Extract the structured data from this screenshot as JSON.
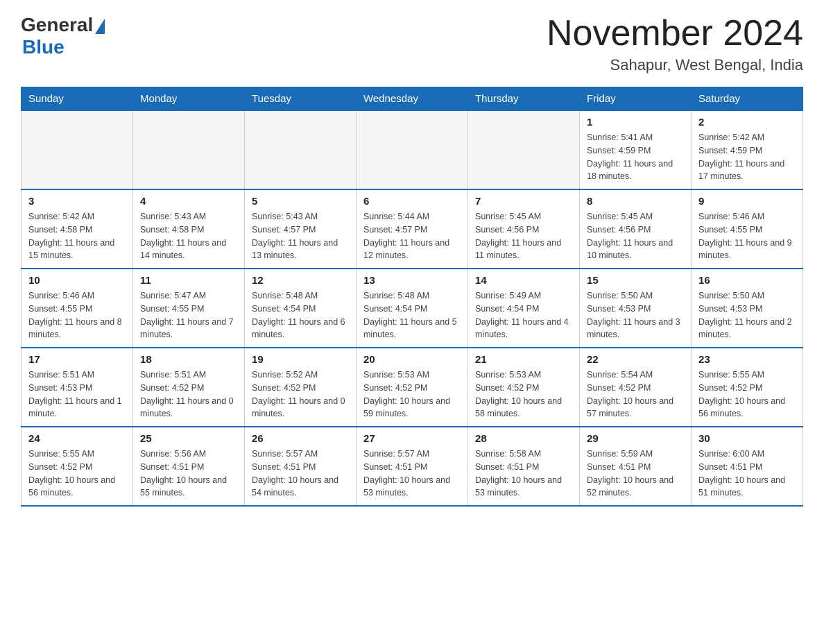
{
  "logo": {
    "general": "General",
    "blue": "Blue"
  },
  "title": "November 2024",
  "subtitle": "Sahapur, West Bengal, India",
  "days_of_week": [
    "Sunday",
    "Monday",
    "Tuesday",
    "Wednesday",
    "Thursday",
    "Friday",
    "Saturday"
  ],
  "weeks": [
    [
      {
        "day": "",
        "info": ""
      },
      {
        "day": "",
        "info": ""
      },
      {
        "day": "",
        "info": ""
      },
      {
        "day": "",
        "info": ""
      },
      {
        "day": "",
        "info": ""
      },
      {
        "day": "1",
        "info": "Sunrise: 5:41 AM\nSunset: 4:59 PM\nDaylight: 11 hours and 18 minutes."
      },
      {
        "day": "2",
        "info": "Sunrise: 5:42 AM\nSunset: 4:59 PM\nDaylight: 11 hours and 17 minutes."
      }
    ],
    [
      {
        "day": "3",
        "info": "Sunrise: 5:42 AM\nSunset: 4:58 PM\nDaylight: 11 hours and 15 minutes."
      },
      {
        "day": "4",
        "info": "Sunrise: 5:43 AM\nSunset: 4:58 PM\nDaylight: 11 hours and 14 minutes."
      },
      {
        "day": "5",
        "info": "Sunrise: 5:43 AM\nSunset: 4:57 PM\nDaylight: 11 hours and 13 minutes."
      },
      {
        "day": "6",
        "info": "Sunrise: 5:44 AM\nSunset: 4:57 PM\nDaylight: 11 hours and 12 minutes."
      },
      {
        "day": "7",
        "info": "Sunrise: 5:45 AM\nSunset: 4:56 PM\nDaylight: 11 hours and 11 minutes."
      },
      {
        "day": "8",
        "info": "Sunrise: 5:45 AM\nSunset: 4:56 PM\nDaylight: 11 hours and 10 minutes."
      },
      {
        "day": "9",
        "info": "Sunrise: 5:46 AM\nSunset: 4:55 PM\nDaylight: 11 hours and 9 minutes."
      }
    ],
    [
      {
        "day": "10",
        "info": "Sunrise: 5:46 AM\nSunset: 4:55 PM\nDaylight: 11 hours and 8 minutes."
      },
      {
        "day": "11",
        "info": "Sunrise: 5:47 AM\nSunset: 4:55 PM\nDaylight: 11 hours and 7 minutes."
      },
      {
        "day": "12",
        "info": "Sunrise: 5:48 AM\nSunset: 4:54 PM\nDaylight: 11 hours and 6 minutes."
      },
      {
        "day": "13",
        "info": "Sunrise: 5:48 AM\nSunset: 4:54 PM\nDaylight: 11 hours and 5 minutes."
      },
      {
        "day": "14",
        "info": "Sunrise: 5:49 AM\nSunset: 4:54 PM\nDaylight: 11 hours and 4 minutes."
      },
      {
        "day": "15",
        "info": "Sunrise: 5:50 AM\nSunset: 4:53 PM\nDaylight: 11 hours and 3 minutes."
      },
      {
        "day": "16",
        "info": "Sunrise: 5:50 AM\nSunset: 4:53 PM\nDaylight: 11 hours and 2 minutes."
      }
    ],
    [
      {
        "day": "17",
        "info": "Sunrise: 5:51 AM\nSunset: 4:53 PM\nDaylight: 11 hours and 1 minute."
      },
      {
        "day": "18",
        "info": "Sunrise: 5:51 AM\nSunset: 4:52 PM\nDaylight: 11 hours and 0 minutes."
      },
      {
        "day": "19",
        "info": "Sunrise: 5:52 AM\nSunset: 4:52 PM\nDaylight: 11 hours and 0 minutes."
      },
      {
        "day": "20",
        "info": "Sunrise: 5:53 AM\nSunset: 4:52 PM\nDaylight: 10 hours and 59 minutes."
      },
      {
        "day": "21",
        "info": "Sunrise: 5:53 AM\nSunset: 4:52 PM\nDaylight: 10 hours and 58 minutes."
      },
      {
        "day": "22",
        "info": "Sunrise: 5:54 AM\nSunset: 4:52 PM\nDaylight: 10 hours and 57 minutes."
      },
      {
        "day": "23",
        "info": "Sunrise: 5:55 AM\nSunset: 4:52 PM\nDaylight: 10 hours and 56 minutes."
      }
    ],
    [
      {
        "day": "24",
        "info": "Sunrise: 5:55 AM\nSunset: 4:52 PM\nDaylight: 10 hours and 56 minutes."
      },
      {
        "day": "25",
        "info": "Sunrise: 5:56 AM\nSunset: 4:51 PM\nDaylight: 10 hours and 55 minutes."
      },
      {
        "day": "26",
        "info": "Sunrise: 5:57 AM\nSunset: 4:51 PM\nDaylight: 10 hours and 54 minutes."
      },
      {
        "day": "27",
        "info": "Sunrise: 5:57 AM\nSunset: 4:51 PM\nDaylight: 10 hours and 53 minutes."
      },
      {
        "day": "28",
        "info": "Sunrise: 5:58 AM\nSunset: 4:51 PM\nDaylight: 10 hours and 53 minutes."
      },
      {
        "day": "29",
        "info": "Sunrise: 5:59 AM\nSunset: 4:51 PM\nDaylight: 10 hours and 52 minutes."
      },
      {
        "day": "30",
        "info": "Sunrise: 6:00 AM\nSunset: 4:51 PM\nDaylight: 10 hours and 51 minutes."
      }
    ]
  ]
}
